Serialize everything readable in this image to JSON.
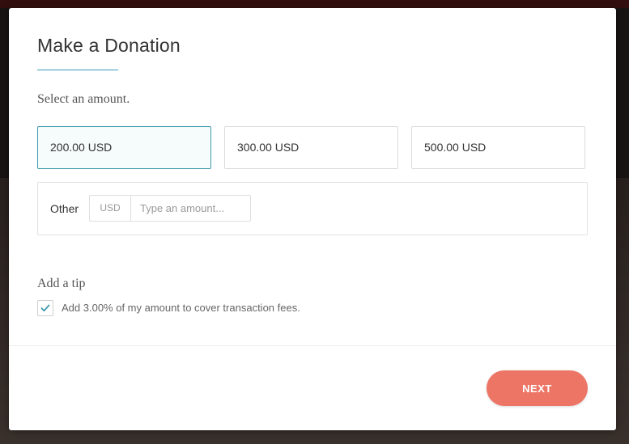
{
  "modal": {
    "title": "Make a Donation",
    "select_amount_label": "Select an amount.",
    "amount_options": [
      {
        "label": "200.00 USD",
        "selected": true
      },
      {
        "label": "300.00 USD",
        "selected": false
      },
      {
        "label": "500.00 USD",
        "selected": false
      }
    ],
    "other": {
      "label": "Other",
      "currency": "USD",
      "input_value": "",
      "input_placeholder": "Type an amount..."
    },
    "tip": {
      "section_label": "Add a tip",
      "checkbox_checked": true,
      "checkbox_label": "Add 3.00% of my amount to cover transaction fees."
    },
    "next_label": "NEXT"
  },
  "colors": {
    "accent": "#3f9aab",
    "title_rule": "#3a9bb8",
    "next_button": "#ed7566"
  },
  "icons": {
    "checkbox": "checkmark-icon"
  }
}
